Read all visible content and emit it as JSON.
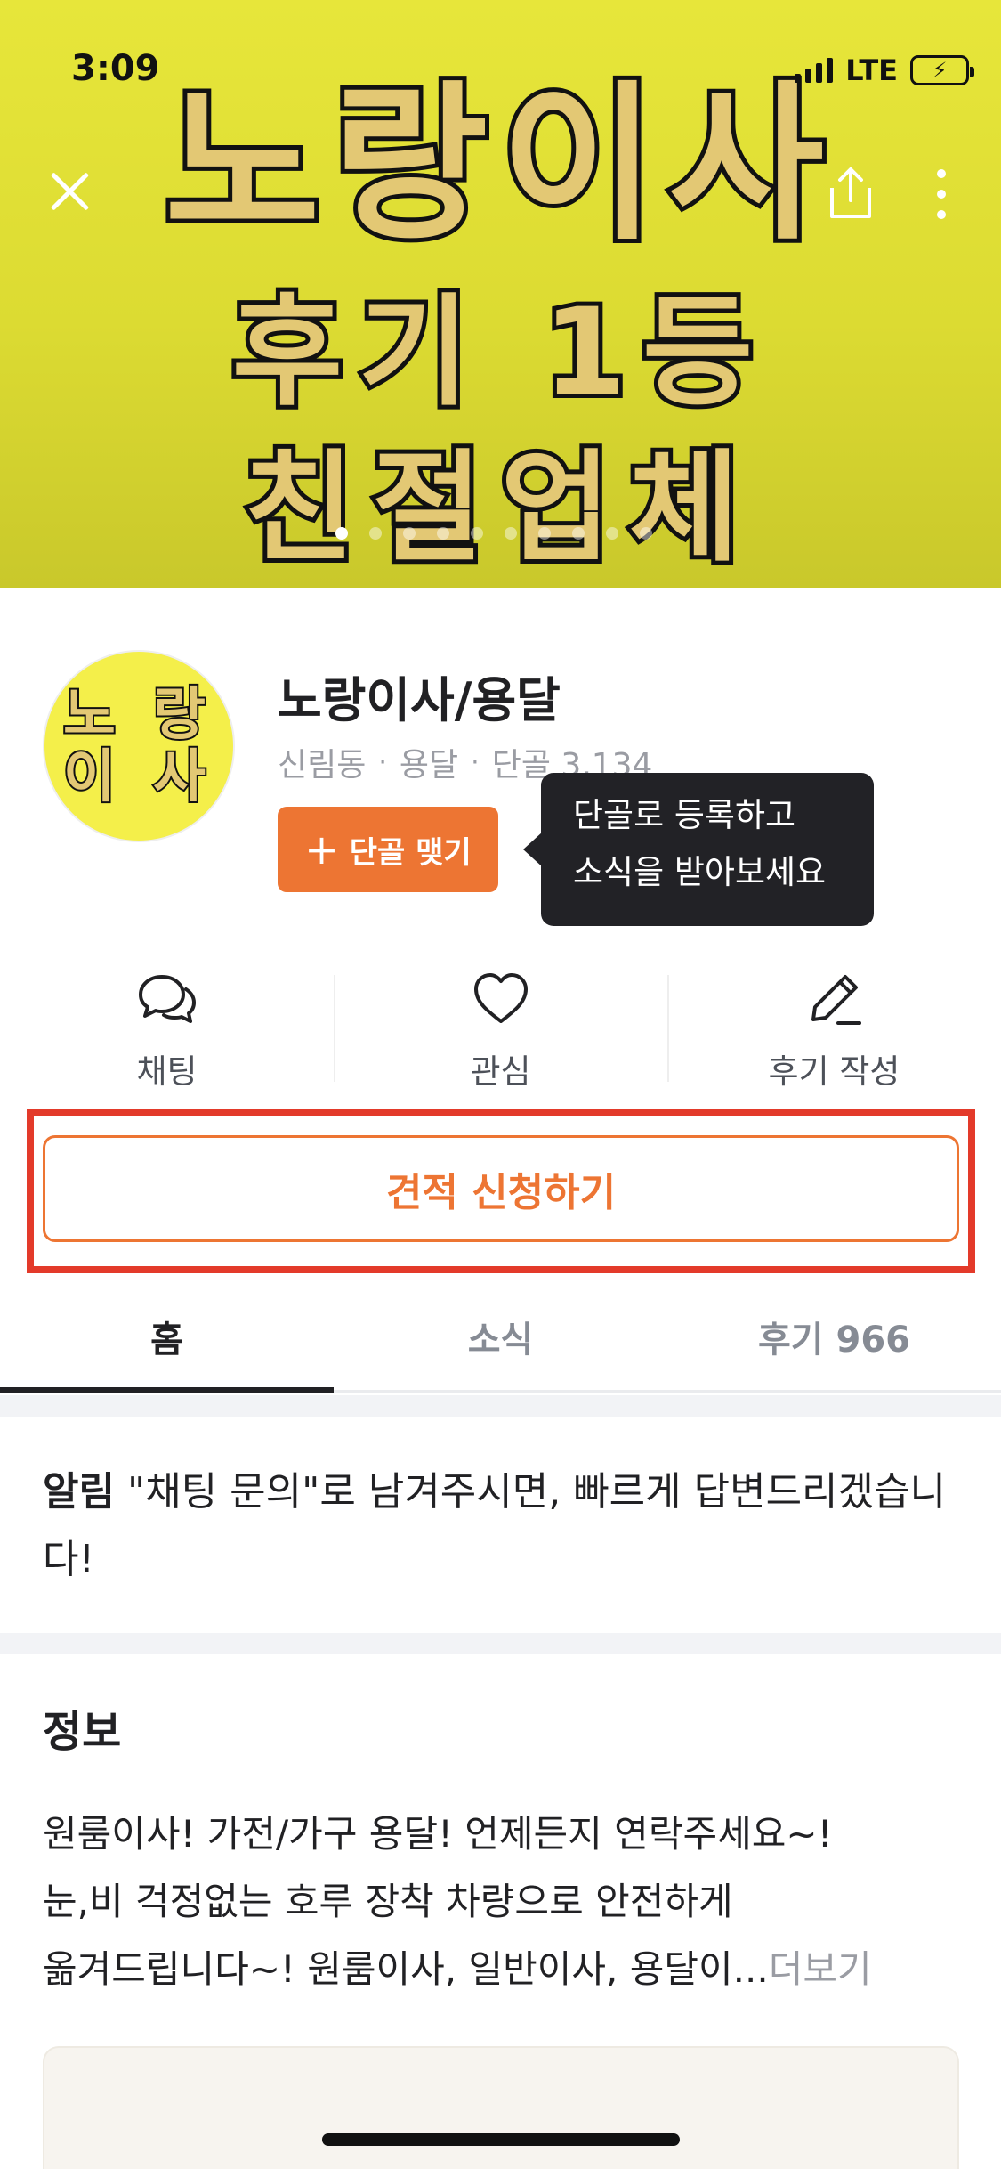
{
  "status_bar": {
    "time": "3:09",
    "network": "LTE"
  },
  "hero": {
    "lines": [
      "노랑이사",
      "후기 1등",
      "친절업체"
    ],
    "page_count": 10,
    "active_page": 1
  },
  "icons": {
    "close": "close-icon",
    "share": "share-icon",
    "more": "more-vertical-icon",
    "chat": "chat-bubble-icon",
    "heart": "heart-icon",
    "pencil": "pencil-icon",
    "plus": "plus-icon"
  },
  "profile": {
    "avatar_text": [
      "노 랑",
      "이 사"
    ],
    "name": "노랑이사/용달",
    "location": "신림동",
    "category": "용달",
    "regulars": "단골 3,134",
    "follow_label": "단골 맺기",
    "tooltip": [
      "단골로 등록하고",
      "소식을 받아보세요"
    ]
  },
  "actions": {
    "chat": "채팅",
    "like": "관심",
    "review": "후기 작성"
  },
  "estimate_label": "견적 신청하기",
  "tabs": [
    "홈",
    "소식",
    "후기 966"
  ],
  "notice": {
    "label": "알림",
    "text": "\"채팅 문의\"로 남겨주시면, 빠르게 답변드리겠습니다!"
  },
  "info": {
    "title": "정보",
    "lines": [
      "원룸이사! 가전/가구 용달! 언제든지 연락주세요~!",
      "눈,비 걱정없는 호루 장착 차량으로 안전하게",
      "옮겨드립니다~! 원룸이사, 일반이사, 용달이..."
    ],
    "more_label": "더보기"
  },
  "colors": {
    "brand_orange": "#ed7533",
    "highlight_red": "#e33a2a",
    "hero_yellow": "#e7e63a"
  }
}
